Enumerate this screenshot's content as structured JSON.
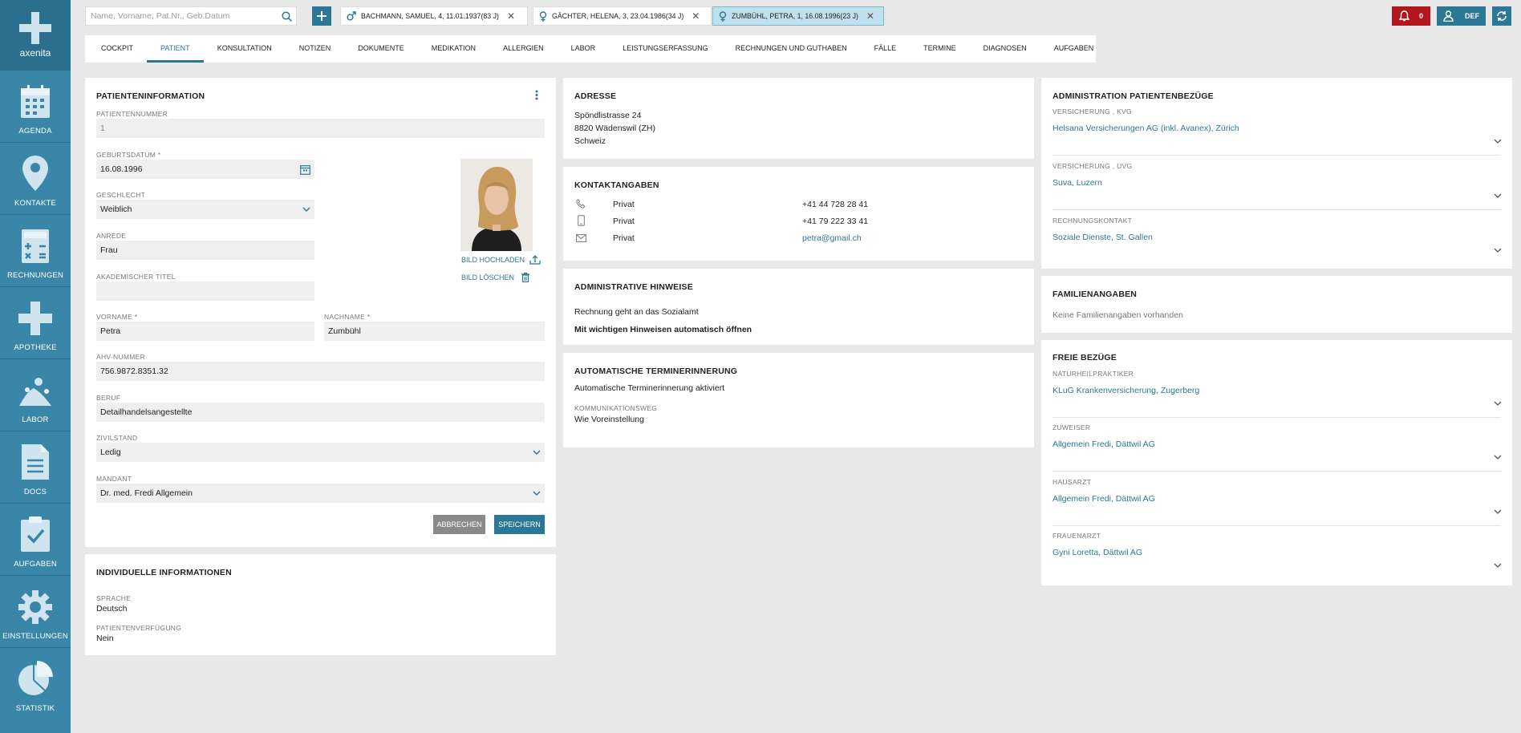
{
  "app": {
    "logo_text": "axenita"
  },
  "sidebar": {
    "items": [
      {
        "label": "AGENDA"
      },
      {
        "label": "KONTAKTE"
      },
      {
        "label": "RECHNUNGEN"
      },
      {
        "label": "APOTHEKE"
      },
      {
        "label": "LABOR"
      },
      {
        "label": "DOCS"
      },
      {
        "label": "AUFGABEN"
      },
      {
        "label": "EINSTELLUNGEN"
      },
      {
        "label": "STATISTIK"
      }
    ]
  },
  "topbar": {
    "search_placeholder": "Name, Vorname, Pat.Nr., Geb.Datum",
    "patient_tabs": [
      {
        "label": "BACHMANN, SAMUEL, 4, 11.01.1937(83 J)",
        "gender": "male"
      },
      {
        "label": "GÄCHTER, HELENA, 3, 23.04.1986(34 J)",
        "gender": "female"
      },
      {
        "label": "ZUMBÜHL, PETRA, 1, 16.08.1996(23 J)",
        "gender": "female",
        "active": true
      }
    ],
    "alert_count": "0",
    "user_initials": "DEF"
  },
  "tabs": [
    "COCKPIT",
    "PATIENT",
    "KONSULTATION",
    "NOTIZEN",
    "DOKUMENTE",
    "MEDIKATION",
    "ALLERGIEN",
    "LABOR",
    "LEISTUNGSERFASSUNG",
    "RECHNUNGEN UND GUTHABEN",
    "FÄLLE",
    "TERMINE",
    "DIAGNOSEN",
    "AUFGABEN"
  ],
  "patient_info": {
    "title": "PATIENTENINFORMATION",
    "patientennummer_label": "PATIENTENNUMMER",
    "patientennummer": "1",
    "geburtsdatum_label": "GEBURTSDATUM *",
    "geburtsdatum": "16.08.1996",
    "geschlecht_label": "GESCHLECHT",
    "geschlecht": "Weiblich",
    "anrede_label": "ANREDE",
    "anrede": "Frau",
    "titel_label": "AKADEMISCHER TITEL",
    "titel": "",
    "vorname_label": "VORNAME *",
    "vorname": "Petra",
    "nachname_label": "NACHNAME *",
    "nachname": "Zumbühl",
    "ahv_label": "AHV-NUMMER",
    "ahv": "756.9872.8351.32",
    "beruf_label": "BERUF",
    "beruf": "Detailhandelsangestellte",
    "zivilstand_label": "ZIVILSTAND",
    "zivilstand": "Ledig",
    "mandant_label": "MANDANT",
    "mandant": "Dr. med. Fredi Allgemein",
    "upload_label": "BILD HOCHLADEN",
    "delete_label": "BILD LÖSCHEN",
    "cancel_label": "ABBRECHEN",
    "save_label": "SPEICHERN"
  },
  "individual": {
    "title": "INDIVIDUELLE INFORMATIONEN",
    "sprache_label": "SPRACHE",
    "sprache": "Deutsch",
    "verfuegung_label": "PATIENTENVERFÜGUNG",
    "verfuegung": "Nein"
  },
  "address": {
    "title": "ADRESSE",
    "line1": "Spöndlistrasse 24",
    "line2": "8820 Wädenswil (ZH)",
    "line3": "Schweiz"
  },
  "contact": {
    "title": "KONTAKTANGABEN",
    "rows": [
      {
        "icon": "phone-icon",
        "type": "Privat",
        "value": "+41 44 728 28 41"
      },
      {
        "icon": "mobile-icon",
        "type": "Privat",
        "value": "+41 79 222 33 41"
      },
      {
        "icon": "mail-icon",
        "type": "Privat",
        "value": "petra@gmail.ch"
      }
    ]
  },
  "admin_hints": {
    "title": "ADMINISTRATIVE HINWEISE",
    "text": "Rechnung geht an das Sozialamt",
    "auto_open": "Mit wichtigen Hinweisen automatisch öffnen"
  },
  "reminder": {
    "title": "AUTOMATISCHE TERMINERINNERUNG",
    "status": "Automatische Terminerinnerung aktiviert",
    "channel_label": "KOMMUNIKATIONSWEG",
    "channel": "Wie Voreinstellung"
  },
  "admin_relations": {
    "title": "ADMINISTRATION PATIENTENBEZÜGE",
    "items": [
      {
        "label": "VERSICHERUNG , KVG",
        "value": "Helsana Versicherungen AG (inkl. Avanex), Zürich"
      },
      {
        "label": "VERSICHERUNG , UVG",
        "value": "Suva, Luzern"
      },
      {
        "label": "RECHNUNGSKONTAKT",
        "value": "Soziale Dienste, St. Gallen"
      }
    ]
  },
  "family": {
    "title": "FAMILIENANGABEN",
    "text": "Keine Familienangaben vorhanden"
  },
  "free_relations": {
    "title": "FREIE BEZÜGE",
    "items": [
      {
        "label": "NATURHEILPRAKTIKER",
        "value": "KLuG Krankenversicherung, Zugerberg"
      },
      {
        "label": "ZUWEISER",
        "value": "Allgemein Fredi, Dättwil AG"
      },
      {
        "label": "HAUSARZT",
        "value": "Allgemein Fredi, Dättwil AG"
      },
      {
        "label": "FRAUENARZT",
        "value": "Gyni Loretta, Dättwil AG"
      }
    ]
  },
  "colors": {
    "brand": "#3a86a8",
    "accent": "#2b7896",
    "alert": "#b3161c"
  }
}
